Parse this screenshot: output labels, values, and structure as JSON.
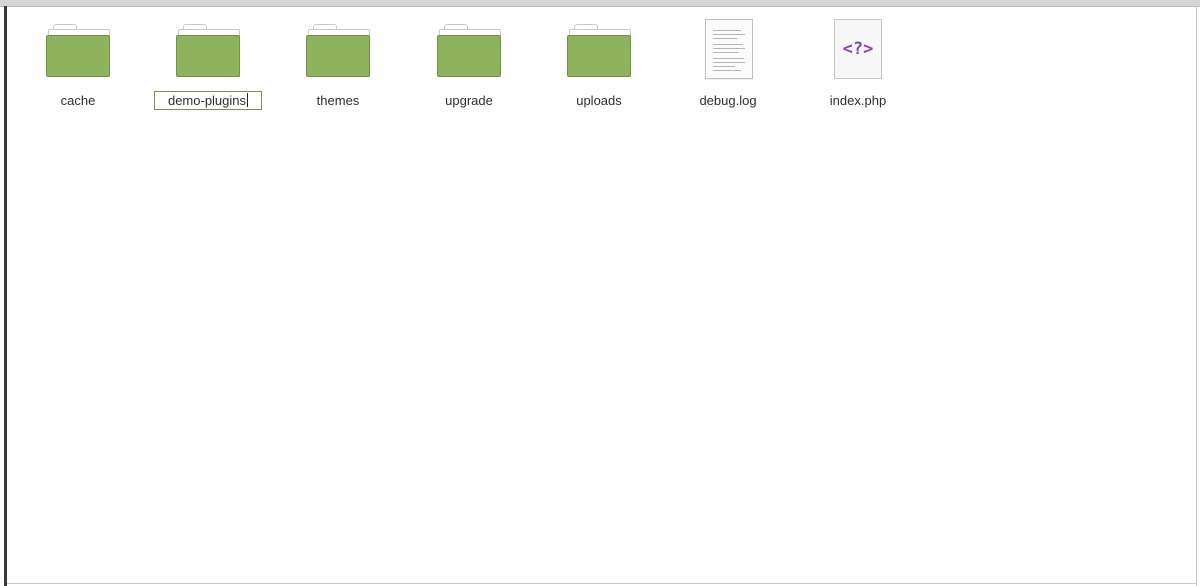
{
  "files": [
    {
      "name": "cache",
      "type": "folder",
      "icon": "folder-icon"
    },
    {
      "name": "demo-plugins",
      "type": "folder",
      "icon": "folder-icon",
      "renaming": true
    },
    {
      "name": "themes",
      "type": "folder",
      "icon": "folder-icon"
    },
    {
      "name": "upgrade",
      "type": "folder",
      "icon": "folder-icon"
    },
    {
      "name": "uploads",
      "type": "folder",
      "icon": "folder-icon"
    },
    {
      "name": "debug.log",
      "type": "text-file",
      "icon": "text-document-icon"
    },
    {
      "name": "index.php",
      "type": "php-file",
      "icon": "php-file-icon",
      "glyph": "<?>"
    }
  ],
  "colors": {
    "folder_fill": "#8db35c",
    "folder_border": "#6f9445",
    "php_glyph": "#8e44ad"
  }
}
